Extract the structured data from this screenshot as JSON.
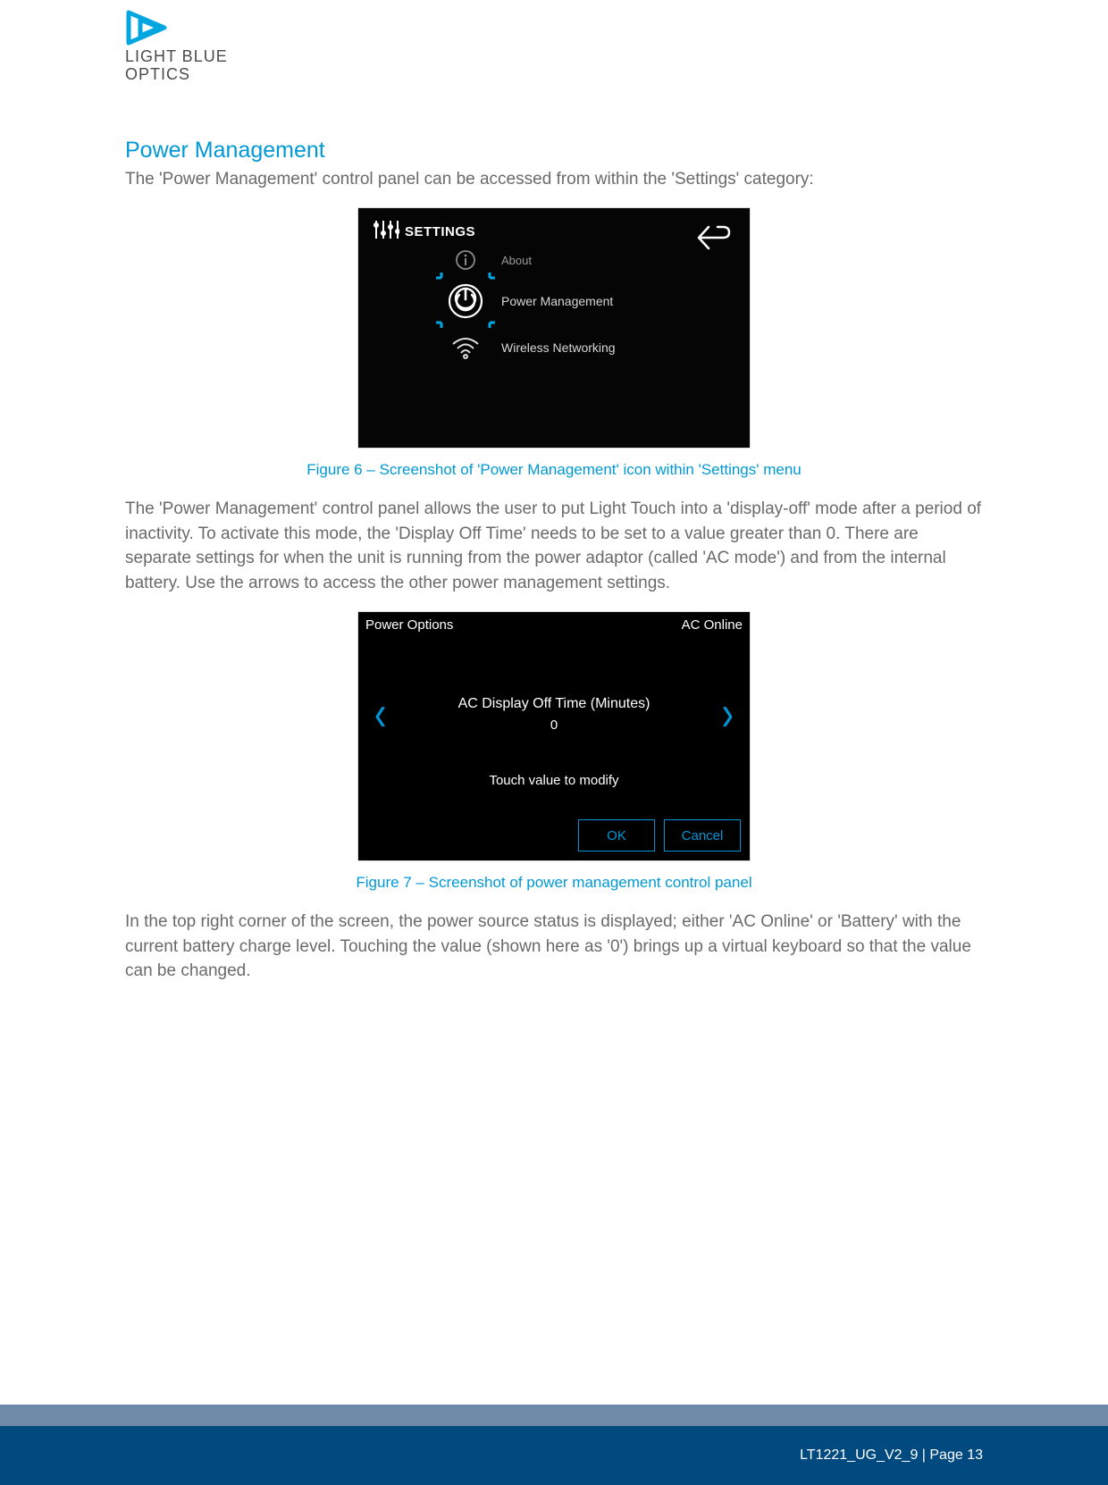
{
  "logo": {
    "line1": "LIGHT BLUE",
    "line2": "OPTICS"
  },
  "section_title": "Power Management",
  "intro_para": "The 'Power Management' control panel can be accessed from within the 'Settings' category:",
  "fig6": {
    "header": "SETTINGS",
    "item_about": "About",
    "item_power": "Power Management",
    "item_wifi": "Wireless Networking",
    "caption": "Figure 6 – Screenshot of 'Power Management' icon within 'Settings' menu"
  },
  "mid_para": "The 'Power Management' control panel allows the user to put Light Touch into a 'display-off' mode after a period of inactivity. To activate this mode, the 'Display Off Time' needs to be set to a value greater than 0. There are separate settings for when the unit is running from the power adaptor (called 'AC mode') and from the internal battery. Use the arrows to access the other power management settings.",
  "fig7": {
    "title": "Power Options",
    "status": "AC Online",
    "setting_label": "AC Display Off Time (Minutes)",
    "value": "0",
    "hint": "Touch value to modify",
    "ok": "OK",
    "cancel": "Cancel",
    "caption": "Figure 7 – Screenshot of power management control panel"
  },
  "end_para": "In the top right corner of the screen, the power source status is displayed; either 'AC Online' or 'Battery' with the current battery charge level. Touching the value (shown here as '0') brings up a virtual keyboard so that the value can be changed.",
  "footer": "LT1221_UG_V2_9 | Page 13"
}
